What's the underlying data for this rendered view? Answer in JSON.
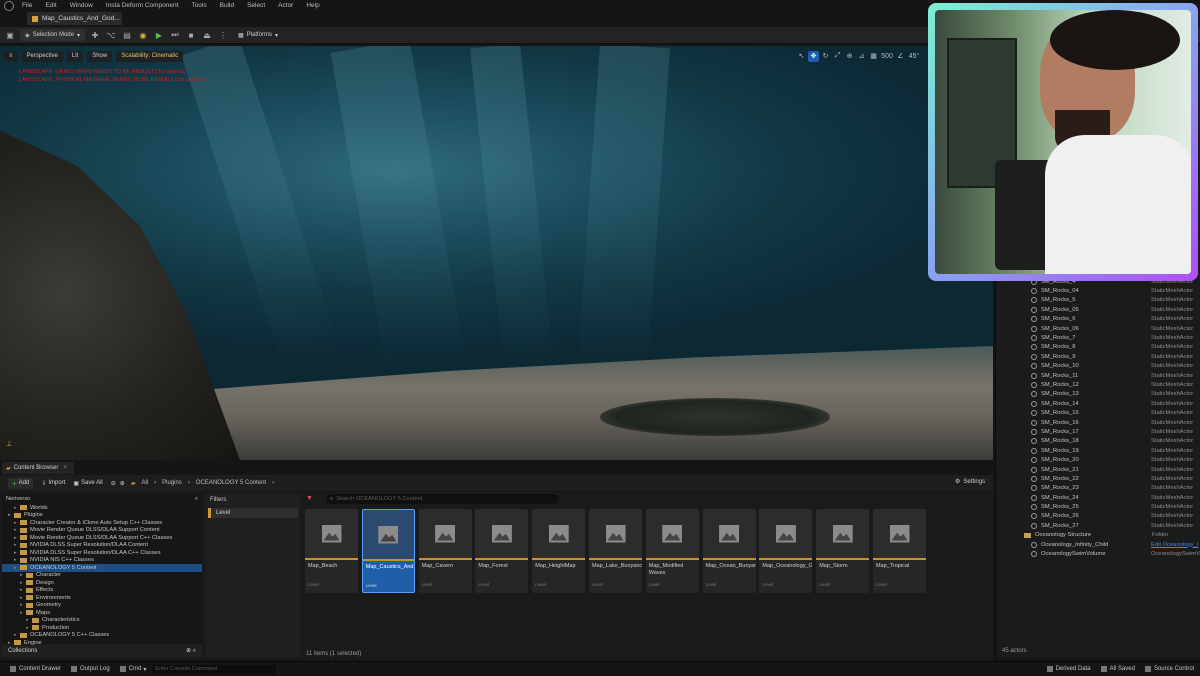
{
  "menu": [
    "File",
    "Edit",
    "Window",
    "Insta Deform Component",
    "Tools",
    "Build",
    "Select",
    "Actor",
    "Help"
  ],
  "level_tab": "Map_Caustics_And_God...",
  "toolbar": {
    "selection_mode": "Selection Mode",
    "platforms": "Platforms"
  },
  "viewport": {
    "perspective": "Perspective",
    "lit": "Lit",
    "show": "Show",
    "scalability": "Scalability: Cinematic",
    "warning1": "LANDSCAPE: GRASS MAPS NEEDS TO BE REBUILT (1st objects)",
    "warning2": "LANDSCAPE: PHYSICAL MATERIAL NEEDS TO BE REBUILT (1st objects)",
    "grid_size": "500",
    "angle": "45°"
  },
  "outliner": {
    "rows": [
      {
        "name": "SM_Rocks_4",
        "type": "StaticMeshActor"
      },
      {
        "name": "SM_Rocks_04",
        "type": "StaticMeshActor"
      },
      {
        "name": "SM_Rocks_5",
        "type": "StaticMeshActor"
      },
      {
        "name": "SM_Rocks_05",
        "type": "StaticMeshActor"
      },
      {
        "name": "SM_Rocks_6",
        "type": "StaticMeshActor"
      },
      {
        "name": "SM_Rocks_06",
        "type": "StaticMeshActor"
      },
      {
        "name": "SM_Rocks_7",
        "type": "StaticMeshActor"
      },
      {
        "name": "SM_Rocks_8",
        "type": "StaticMeshActor"
      },
      {
        "name": "SM_Rocks_9",
        "type": "StaticMeshActor"
      },
      {
        "name": "SM_Rocks_10",
        "type": "StaticMeshActor"
      },
      {
        "name": "SM_Rocks_11",
        "type": "StaticMeshActor"
      },
      {
        "name": "SM_Rocks_12",
        "type": "StaticMeshActor"
      },
      {
        "name": "SM_Rocks_13",
        "type": "StaticMeshActor"
      },
      {
        "name": "SM_Rocks_14",
        "type": "StaticMeshActor"
      },
      {
        "name": "SM_Rocks_15",
        "type": "StaticMeshActor"
      },
      {
        "name": "SM_Rocks_16",
        "type": "StaticMeshActor"
      },
      {
        "name": "SM_Rocks_17",
        "type": "StaticMeshActor"
      },
      {
        "name": "SM_Rocks_18",
        "type": "StaticMeshActor"
      },
      {
        "name": "SM_Rocks_19",
        "type": "StaticMeshActor"
      },
      {
        "name": "SM_Rocks_20",
        "type": "StaticMeshActor"
      },
      {
        "name": "SM_Rocks_21",
        "type": "StaticMeshActor"
      },
      {
        "name": "SM_Rocks_22",
        "type": "StaticMeshActor"
      },
      {
        "name": "SM_Rocks_23",
        "type": "StaticMeshActor"
      },
      {
        "name": "SM_Rocks_24",
        "type": "StaticMeshActor"
      },
      {
        "name": "SM_Rocks_25",
        "type": "StaticMeshActor"
      },
      {
        "name": "SM_Rocks_26",
        "type": "StaticMeshActor"
      },
      {
        "name": "SM_Rocks_27",
        "type": "StaticMeshActor"
      }
    ],
    "folder": {
      "name": "Oceanology Structure",
      "type": "Folder"
    },
    "child1": {
      "name": "Oceanology_Infinity_Child",
      "type": "Edit Oceanology_I"
    },
    "child2": {
      "name": "OceanologySwimVolume",
      "type": "OceanologySwimV"
    },
    "actors": "45 actors"
  },
  "content_browser": {
    "tab": "Content Browser",
    "add": "Add",
    "import": "Import",
    "save_all": "Save All",
    "crumbs": [
      "All",
      "Plugins",
      "OCEANOLOGY 5 Content"
    ],
    "settings": "Settings",
    "search_placeholder": "Search OCEANOLOGY 5 Content",
    "filters_title": "Filters",
    "filter_level": "Level",
    "tree_root": "Neriverso",
    "folders": [
      {
        "name": "Worlds",
        "indent": 2,
        "sel": false
      },
      {
        "name": "Plugins",
        "indent": 1,
        "sel": false
      },
      {
        "name": "Character Creator & iClone Auto Setup C++ Classes",
        "indent": 2,
        "sel": false
      },
      {
        "name": "Movie Render Queue DLSS/DLAA Support Content",
        "indent": 2,
        "sel": false
      },
      {
        "name": "Movie Render Queue DLSS/DLAA Support C++ Classes",
        "indent": 2,
        "sel": false
      },
      {
        "name": "NVIDIA DLSS Super Resolution/DLAA Content",
        "indent": 2,
        "sel": false
      },
      {
        "name": "NVIDIA DLSS Super Resolution/DLAA C++ Classes",
        "indent": 2,
        "sel": false
      },
      {
        "name": "NVIDIA NIS C++ Classes",
        "indent": 2,
        "sel": false
      },
      {
        "name": "OCEANOLOGY 5 Content",
        "indent": 2,
        "sel": true
      },
      {
        "name": "Character",
        "indent": 3,
        "sel": false
      },
      {
        "name": "Design",
        "indent": 3,
        "sel": false
      },
      {
        "name": "Effects",
        "indent": 3,
        "sel": false
      },
      {
        "name": "Environments",
        "indent": 3,
        "sel": false
      },
      {
        "name": "Geometry",
        "indent": 3,
        "sel": false
      },
      {
        "name": "Maps",
        "indent": 3,
        "sel": false
      },
      {
        "name": "Characteristics",
        "indent": 4,
        "sel": false
      },
      {
        "name": "Production",
        "indent": 4,
        "sel": false
      },
      {
        "name": "OCEANOLOGY 5 C++ Classes",
        "indent": 2,
        "sel": false
      },
      {
        "name": "Engine",
        "indent": 1,
        "sel": false
      }
    ],
    "collections": "Collections",
    "assets": [
      {
        "name": "Map_Beach",
        "type": "Level"
      },
      {
        "name": "Map_Caustics_And_GodRays",
        "type": "Level"
      },
      {
        "name": "Map_Cavern",
        "type": "Level"
      },
      {
        "name": "Map_Forest",
        "type": "Level"
      },
      {
        "name": "Map_HeightMap",
        "type": "Level"
      },
      {
        "name": "Map_Lake_Buoyancy",
        "type": "Level"
      },
      {
        "name": "Map_Modified Waves",
        "type": "Level"
      },
      {
        "name": "Map_Ocean_Buoyancy",
        "type": "Level"
      },
      {
        "name": "Map_Oceanology_GuidTree",
        "type": "Level"
      },
      {
        "name": "Map_Storm",
        "type": "Level"
      },
      {
        "name": "Map_Tropical",
        "type": "Level"
      }
    ],
    "selected_index": 1,
    "item_count": "11 items (1 selected)"
  },
  "statusbar": {
    "content_drawer": "Content Drawer",
    "output_log": "Output Log",
    "cmd": "Cmd",
    "console_placeholder": "Enter Console Command",
    "derived_data": "Derived Data",
    "all_saved": "All Saved",
    "source_control": "Source Control"
  },
  "colors": {
    "accent": "#1f5fa8",
    "level_orange": "#c99328",
    "warning": "#d21e1e"
  }
}
